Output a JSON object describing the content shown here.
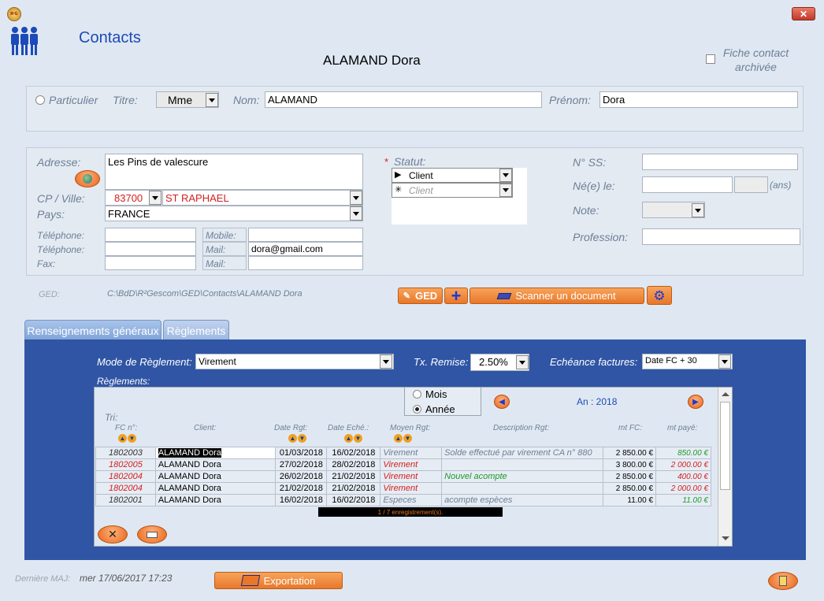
{
  "window": {
    "title": "Contacts",
    "contact_name": "ALAMAND Dora",
    "close_icon": "close-icon",
    "app_icon": "app-logo-icon"
  },
  "archived": {
    "label_line1": "Fiche contact",
    "label_line2": "archivée",
    "checked": false
  },
  "identity": {
    "particulier_label": "Particulier",
    "titre_label": "Titre:",
    "titre_value": "Mme",
    "nom_label": "Nom:",
    "nom_value": "ALAMAND",
    "prenom_label": "Prénom:",
    "prenom_value": "Dora"
  },
  "address": {
    "adresse_label": "Adresse:",
    "adresse_value": "Les Pins de valescure",
    "cp_ville_label": "CP / Ville:",
    "cp_value": "83700",
    "ville_value": "ST RAPHAEL",
    "pays_label": "Pays:",
    "pays_value": "FRANCE",
    "tel1_label": "Téléphone:",
    "tel2_label": "Téléphone:",
    "fax_label": "Fax:",
    "mobile_label": "Mobile:",
    "mail1_label": "Mail:",
    "mail1_value": "dora@gmail.com",
    "mail2_label": "Mail:"
  },
  "statut": {
    "required_mark": "*",
    "label": "Statut:",
    "rows": [
      {
        "marker": "▶",
        "value": "Client"
      },
      {
        "marker": "✳",
        "value": "Client"
      }
    ]
  },
  "extra": {
    "ss_label": "N° SS:",
    "ne_label": "Né(e) le:",
    "ans_label": "(ans)",
    "note_label": "Note:",
    "profession_label": "Profession:"
  },
  "ged": {
    "label": "GED:",
    "path": "C:\\BdD\\R²Gescom\\GED\\Contacts\\ALAMAND Dora",
    "ged_button": "GED",
    "add_button": "+",
    "scan_button": "Scanner un document"
  },
  "tabs": [
    {
      "label": "Renseignements généraux"
    },
    {
      "label": "Règlements"
    }
  ],
  "reglements": {
    "mode_label": "Mode de Règlement:",
    "mode_value": "Virement",
    "remise_label": "Tx. Remise:",
    "remise_value": "2.50%",
    "echeance_label": "Echéance factures:",
    "echeance_value": "Date FC + 30",
    "reglements_label": "Règlements:",
    "period": {
      "mois_label": "Mois",
      "annee_label": "Année",
      "selected": "Année",
      "an_label": "An : 2018"
    },
    "tri_label": "Tri:",
    "headers": [
      "FC n°:",
      "Client:",
      "Date Rgt:",
      "Date Eché.:",
      "Moyen Rgt:",
      "Description Rgt:",
      "mt FC:",
      "mt payé:"
    ],
    "rows": [
      {
        "fc": "1802003",
        "client": "ALAMAND Dora",
        "date_rgt": "01/03/2018",
        "date_ech": "16/02/2018",
        "moyen": "Virement",
        "desc": "Solde effectué par virement CA n° 880",
        "mt_fc": "2 850.00 €",
        "mt_paye": "850.00 €",
        "fc_color": "#333333",
        "moyen_color": "#6d7f96",
        "desc_color": "#6d7f96",
        "paye_color": "#1d9a2a"
      },
      {
        "fc": "1802005",
        "client": "ALAMAND Dora",
        "date_rgt": "27/02/2018",
        "date_ech": "28/02/2018",
        "moyen": "Virement",
        "desc": "",
        "mt_fc": "3 800.00 €",
        "mt_paye": "2 000.00 €",
        "fc_color": "#d42020",
        "moyen_color": "#d42020",
        "desc_color": "#6d7f96",
        "paye_color": "#d42020"
      },
      {
        "fc": "1802004",
        "client": "ALAMAND Dora",
        "date_rgt": "26/02/2018",
        "date_ech": "21/02/2018",
        "moyen": "Virement",
        "desc": "Nouvel acompte",
        "mt_fc": "2 850.00 €",
        "mt_paye": "400.00 €",
        "fc_color": "#d42020",
        "moyen_color": "#d42020",
        "desc_color": "#1d9a2a",
        "paye_color": "#d42020"
      },
      {
        "fc": "1802004",
        "client": "ALAMAND Dora",
        "date_rgt": "21/02/2018",
        "date_ech": "21/02/2018",
        "moyen": "Virement",
        "desc": "",
        "mt_fc": "2 850.00 €",
        "mt_paye": "2 000.00 €",
        "fc_color": "#d42020",
        "moyen_color": "#d42020",
        "desc_color": "#6d7f96",
        "paye_color": "#d42020"
      },
      {
        "fc": "1802001",
        "client": "ALAMAND Dora",
        "date_rgt": "16/02/2018",
        "date_ech": "16/02/2018",
        "moyen": "Especes",
        "desc": "acompte espèces",
        "mt_fc": "11.00 €",
        "mt_paye": "11.00 €",
        "fc_color": "#333333",
        "moyen_color": "#6d7f96",
        "desc_color": "#6d7f96",
        "paye_color": "#1d9a2a"
      }
    ],
    "record_count": "1 / 7 enregistrement(s)."
  },
  "footer": {
    "maj_label": "Dernière MAJ:",
    "maj_value": "mer 17/06/2017 17:23",
    "export_button": "Exportation"
  },
  "colors": {
    "accent_blue": "#2f55a4",
    "orange": "#e8772a",
    "background": "#dfe8f2"
  }
}
